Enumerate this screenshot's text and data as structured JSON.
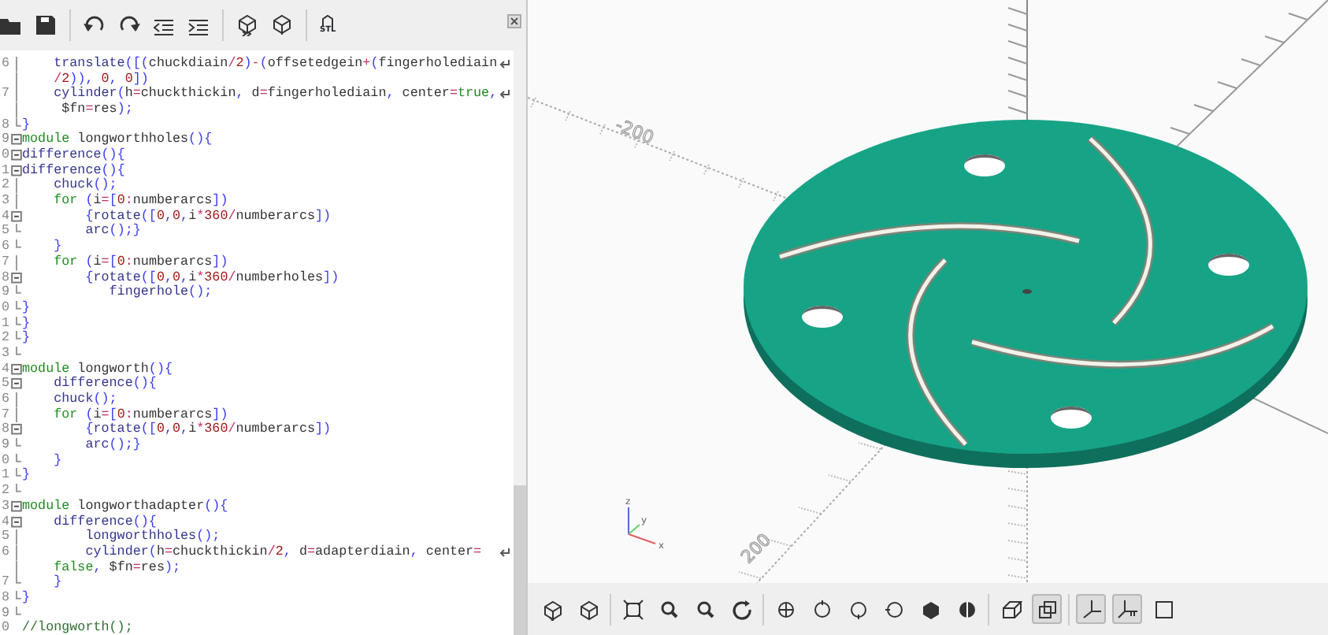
{
  "editor": {
    "export_label": "STL",
    "rows": [
      {
        "num": "6",
        "kind": "line",
        "wrap": true,
        "tokens": [
          {
            "kind": "f",
            "text": "    translate"
          },
          {
            "kind": "p",
            "text": "([("
          },
          {
            "kind": "v",
            "text": "chuckdiain"
          },
          {
            "kind": "o",
            "text": "/"
          },
          {
            "kind": "n",
            "text": "2"
          },
          {
            "kind": "p",
            "text": ")"
          },
          {
            "kind": "o",
            "text": "-"
          },
          {
            "kind": "p",
            "text": "("
          },
          {
            "kind": "v",
            "text": "offsetedgein"
          },
          {
            "kind": "o",
            "text": "+"
          },
          {
            "kind": "p",
            "text": "("
          },
          {
            "kind": "v",
            "text": "fingerholediain"
          }
        ]
      },
      {
        "kind": "line",
        "tokens": [
          {
            "kind": "o",
            "text": "    /"
          },
          {
            "kind": "n",
            "text": "2"
          },
          {
            "kind": "p",
            "text": ")), "
          },
          {
            "kind": "n",
            "text": "0"
          },
          {
            "kind": "p",
            "text": ", "
          },
          {
            "kind": "n",
            "text": "0"
          },
          {
            "kind": "p",
            "text": "])"
          }
        ]
      },
      {
        "num": "7",
        "kind": "line",
        "wrap": true,
        "tokens": [
          {
            "kind": "f",
            "text": "    cylinder"
          },
          {
            "kind": "p",
            "text": "("
          },
          {
            "kind": "v",
            "text": "h"
          },
          {
            "kind": "o",
            "text": "="
          },
          {
            "kind": "v",
            "text": "chuckthickin"
          },
          {
            "kind": "p",
            "text": ", "
          },
          {
            "kind": "v",
            "text": "d"
          },
          {
            "kind": "o",
            "text": "="
          },
          {
            "kind": "v",
            "text": "fingerholediain"
          },
          {
            "kind": "p",
            "text": ", "
          },
          {
            "kind": "v",
            "text": "center"
          },
          {
            "kind": "o",
            "text": "="
          },
          {
            "kind": "k",
            "text": "true"
          },
          {
            "kind": "p",
            "text": ","
          }
        ]
      },
      {
        "kind": "line",
        "tokens": [
          {
            "kind": "v",
            "text": "     $fn"
          },
          {
            "kind": "o",
            "text": "="
          },
          {
            "kind": "v",
            "text": "res"
          },
          {
            "kind": "p",
            "text": ");"
          }
        ]
      },
      {
        "num": "8",
        "kind": "end",
        "tokens": [
          {
            "kind": "p",
            "text": "}"
          }
        ]
      },
      {
        "num": "9",
        "kind": "start",
        "tokens": [
          {
            "kind": "k",
            "text": "module"
          },
          {
            "kind": "v",
            "text": " longworthholes"
          },
          {
            "kind": "p",
            "text": "(){"
          }
        ]
      },
      {
        "num": "0",
        "kind": "start",
        "tokens": [
          {
            "kind": "f",
            "text": "difference"
          },
          {
            "kind": "p",
            "text": "(){"
          }
        ]
      },
      {
        "num": "1",
        "kind": "start",
        "tokens": [
          {
            "kind": "f",
            "text": "difference"
          },
          {
            "kind": "p",
            "text": "(){"
          }
        ]
      },
      {
        "num": "2",
        "kind": "line",
        "tokens": [
          {
            "kind": "f",
            "text": "    chuck"
          },
          {
            "kind": "p",
            "text": "();"
          }
        ]
      },
      {
        "num": "3",
        "kind": "line",
        "tokens": [
          {
            "kind": "k",
            "text": "    for"
          },
          {
            "kind": "p",
            "text": " ("
          },
          {
            "kind": "v",
            "text": "i"
          },
          {
            "kind": "o",
            "text": "="
          },
          {
            "kind": "p",
            "text": "["
          },
          {
            "kind": "n",
            "text": "0"
          },
          {
            "kind": "o",
            "text": ":"
          },
          {
            "kind": "v",
            "text": "numberarcs"
          },
          {
            "kind": "p",
            "text": "])"
          }
        ]
      },
      {
        "num": "4",
        "kind": "start",
        "tokens": [
          {
            "kind": "p",
            "text": "        {"
          },
          {
            "kind": "f",
            "text": "rotate"
          },
          {
            "kind": "p",
            "text": "(["
          },
          {
            "kind": "n",
            "text": "0"
          },
          {
            "kind": "p",
            "text": ","
          },
          {
            "kind": "n",
            "text": "0"
          },
          {
            "kind": "p",
            "text": ","
          },
          {
            "kind": "v",
            "text": "i"
          },
          {
            "kind": "o",
            "text": "*"
          },
          {
            "kind": "n",
            "text": "360"
          },
          {
            "kind": "o",
            "text": "/"
          },
          {
            "kind": "v",
            "text": "numberarcs"
          },
          {
            "kind": "p",
            "text": "])"
          }
        ]
      },
      {
        "num": "5",
        "kind": "end",
        "tokens": [
          {
            "kind": "f",
            "text": "        arc"
          },
          {
            "kind": "p",
            "text": "();}"
          }
        ]
      },
      {
        "num": "6",
        "kind": "end",
        "tokens": [
          {
            "kind": "p",
            "text": "    }"
          }
        ]
      },
      {
        "num": "7",
        "kind": "line",
        "tokens": [
          {
            "kind": "k",
            "text": "    for"
          },
          {
            "kind": "p",
            "text": " ("
          },
          {
            "kind": "v",
            "text": "i"
          },
          {
            "kind": "o",
            "text": "="
          },
          {
            "kind": "p",
            "text": "["
          },
          {
            "kind": "n",
            "text": "0"
          },
          {
            "kind": "o",
            "text": ":"
          },
          {
            "kind": "v",
            "text": "numberarcs"
          },
          {
            "kind": "p",
            "text": "])"
          }
        ]
      },
      {
        "num": "8",
        "kind": "start",
        "tokens": [
          {
            "kind": "p",
            "text": "        {"
          },
          {
            "kind": "f",
            "text": "rotate"
          },
          {
            "kind": "p",
            "text": "(["
          },
          {
            "kind": "n",
            "text": "0"
          },
          {
            "kind": "p",
            "text": ","
          },
          {
            "kind": "n",
            "text": "0"
          },
          {
            "kind": "p",
            "text": ","
          },
          {
            "kind": "v",
            "text": "i"
          },
          {
            "kind": "o",
            "text": "*"
          },
          {
            "kind": "n",
            "text": "360"
          },
          {
            "kind": "o",
            "text": "/"
          },
          {
            "kind": "v",
            "text": "numberholes"
          },
          {
            "kind": "p",
            "text": "])"
          }
        ]
      },
      {
        "num": "9",
        "kind": "end",
        "tokens": [
          {
            "kind": "f",
            "text": "           fingerhole"
          },
          {
            "kind": "p",
            "text": "();"
          }
        ]
      },
      {
        "num": "0",
        "kind": "end",
        "tokens": [
          {
            "kind": "p",
            "text": "}"
          }
        ]
      },
      {
        "num": "1",
        "kind": "end",
        "tokens": [
          {
            "kind": "p",
            "text": "}"
          }
        ]
      },
      {
        "num": "2",
        "kind": "end",
        "tokens": [
          {
            "kind": "p",
            "text": "}"
          }
        ]
      },
      {
        "num": "3",
        "kind": "end"
      },
      {
        "num": "4",
        "kind": "start",
        "tokens": [
          {
            "kind": "k",
            "text": "module"
          },
          {
            "kind": "v",
            "text": " longworth"
          },
          {
            "kind": "p",
            "text": "(){"
          }
        ]
      },
      {
        "num": "5",
        "kind": "start",
        "tokens": [
          {
            "kind": "f",
            "text": "    difference"
          },
          {
            "kind": "p",
            "text": "(){"
          }
        ]
      },
      {
        "num": "6",
        "kind": "line",
        "tokens": [
          {
            "kind": "f",
            "text": "    chuck"
          },
          {
            "kind": "p",
            "text": "();"
          }
        ]
      },
      {
        "num": "7",
        "kind": "line",
        "tokens": [
          {
            "kind": "k",
            "text": "    for"
          },
          {
            "kind": "p",
            "text": " ("
          },
          {
            "kind": "v",
            "text": "i"
          },
          {
            "kind": "o",
            "text": "="
          },
          {
            "kind": "p",
            "text": "["
          },
          {
            "kind": "n",
            "text": "0"
          },
          {
            "kind": "o",
            "text": ":"
          },
          {
            "kind": "v",
            "text": "numberarcs"
          },
          {
            "kind": "p",
            "text": "])"
          }
        ]
      },
      {
        "num": "8",
        "kind": "start",
        "tokens": [
          {
            "kind": "p",
            "text": "        {"
          },
          {
            "kind": "f",
            "text": "rotate"
          },
          {
            "kind": "p",
            "text": "(["
          },
          {
            "kind": "n",
            "text": "0"
          },
          {
            "kind": "p",
            "text": ","
          },
          {
            "kind": "n",
            "text": "0"
          },
          {
            "kind": "p",
            "text": ","
          },
          {
            "kind": "v",
            "text": "i"
          },
          {
            "kind": "o",
            "text": "*"
          },
          {
            "kind": "n",
            "text": "360"
          },
          {
            "kind": "o",
            "text": "/"
          },
          {
            "kind": "v",
            "text": "numberarcs"
          },
          {
            "kind": "p",
            "text": "])"
          }
        ]
      },
      {
        "num": "9",
        "kind": "end",
        "tokens": [
          {
            "kind": "f",
            "text": "        arc"
          },
          {
            "kind": "p",
            "text": "();}"
          }
        ]
      },
      {
        "num": "0",
        "kind": "end",
        "tokens": [
          {
            "kind": "p",
            "text": "    }"
          }
        ]
      },
      {
        "num": "1",
        "kind": "end",
        "tokens": [
          {
            "kind": "p",
            "text": "}"
          }
        ]
      },
      {
        "num": "2",
        "kind": "end"
      },
      {
        "num": "3",
        "kind": "start",
        "tokens": [
          {
            "kind": "k",
            "text": "module"
          },
          {
            "kind": "v",
            "text": " longworthadapter"
          },
          {
            "kind": "p",
            "text": "(){"
          }
        ]
      },
      {
        "num": "4",
        "kind": "start",
        "tokens": [
          {
            "kind": "f",
            "text": "    difference"
          },
          {
            "kind": "p",
            "text": "(){"
          }
        ]
      },
      {
        "num": "5",
        "kind": "line",
        "tokens": [
          {
            "kind": "f",
            "text": "        longworthholes"
          },
          {
            "kind": "p",
            "text": "();"
          }
        ]
      },
      {
        "num": "6",
        "kind": "line",
        "wrap": true,
        "tokens": [
          {
            "kind": "f",
            "text": "        cylinder"
          },
          {
            "kind": "p",
            "text": "("
          },
          {
            "kind": "v",
            "text": "h"
          },
          {
            "kind": "o",
            "text": "="
          },
          {
            "kind": "v",
            "text": "chuckthickin"
          },
          {
            "kind": "o",
            "text": "/"
          },
          {
            "kind": "n",
            "text": "2"
          },
          {
            "kind": "p",
            "text": ", "
          },
          {
            "kind": "v",
            "text": "d"
          },
          {
            "kind": "o",
            "text": "="
          },
          {
            "kind": "v",
            "text": "adapterdiain"
          },
          {
            "kind": "p",
            "text": ", "
          },
          {
            "kind": "v",
            "text": "center"
          },
          {
            "kind": "o",
            "text": "="
          }
        ]
      },
      {
        "kind": "line",
        "tokens": [
          {
            "kind": "k",
            "text": "    false"
          },
          {
            "kind": "p",
            "text": ", "
          },
          {
            "kind": "v",
            "text": "$fn"
          },
          {
            "kind": "o",
            "text": "="
          },
          {
            "kind": "v",
            "text": "res"
          },
          {
            "kind": "p",
            "text": ");"
          }
        ]
      },
      {
        "num": "7",
        "kind": "end",
        "tokens": [
          {
            "kind": "p",
            "text": "    }"
          }
        ]
      },
      {
        "num": "8",
        "kind": "end",
        "tokens": [
          {
            "kind": "p",
            "text": "}"
          }
        ]
      },
      {
        "num": "9",
        "kind": "end"
      },
      {
        "num": "0",
        "kind": "plain",
        "tokens": [
          {
            "kind": "c",
            "text": "//longworth();"
          }
        ]
      }
    ]
  },
  "viewport": {
    "axis_labels": [
      "-200",
      "200"
    ],
    "gizmo_labels": [
      "z",
      "y",
      "x"
    ],
    "toolbar": [
      {
        "kind": "preview",
        "selected": false
      },
      {
        "kind": "render",
        "selected": false
      },
      {
        "kind": "viewall",
        "selected": false
      },
      {
        "kind": "zoomin",
        "selected": false
      },
      {
        "kind": "zoomout",
        "selected": false
      },
      {
        "kind": "reset",
        "selected": false
      },
      {
        "kind": "right",
        "selected": false
      },
      {
        "kind": "top",
        "selected": false
      },
      {
        "kind": "bottom",
        "selected": false
      },
      {
        "kind": "left",
        "selected": false
      },
      {
        "kind": "front",
        "selected": false
      },
      {
        "kind": "back",
        "selected": false
      },
      {
        "kind": "perspective",
        "selected": false
      },
      {
        "kind": "ortho",
        "selected": true
      },
      {
        "kind": "axes",
        "selected": true
      },
      {
        "kind": "scale",
        "selected": true
      },
      {
        "kind": "edges",
        "selected": false
      }
    ]
  }
}
